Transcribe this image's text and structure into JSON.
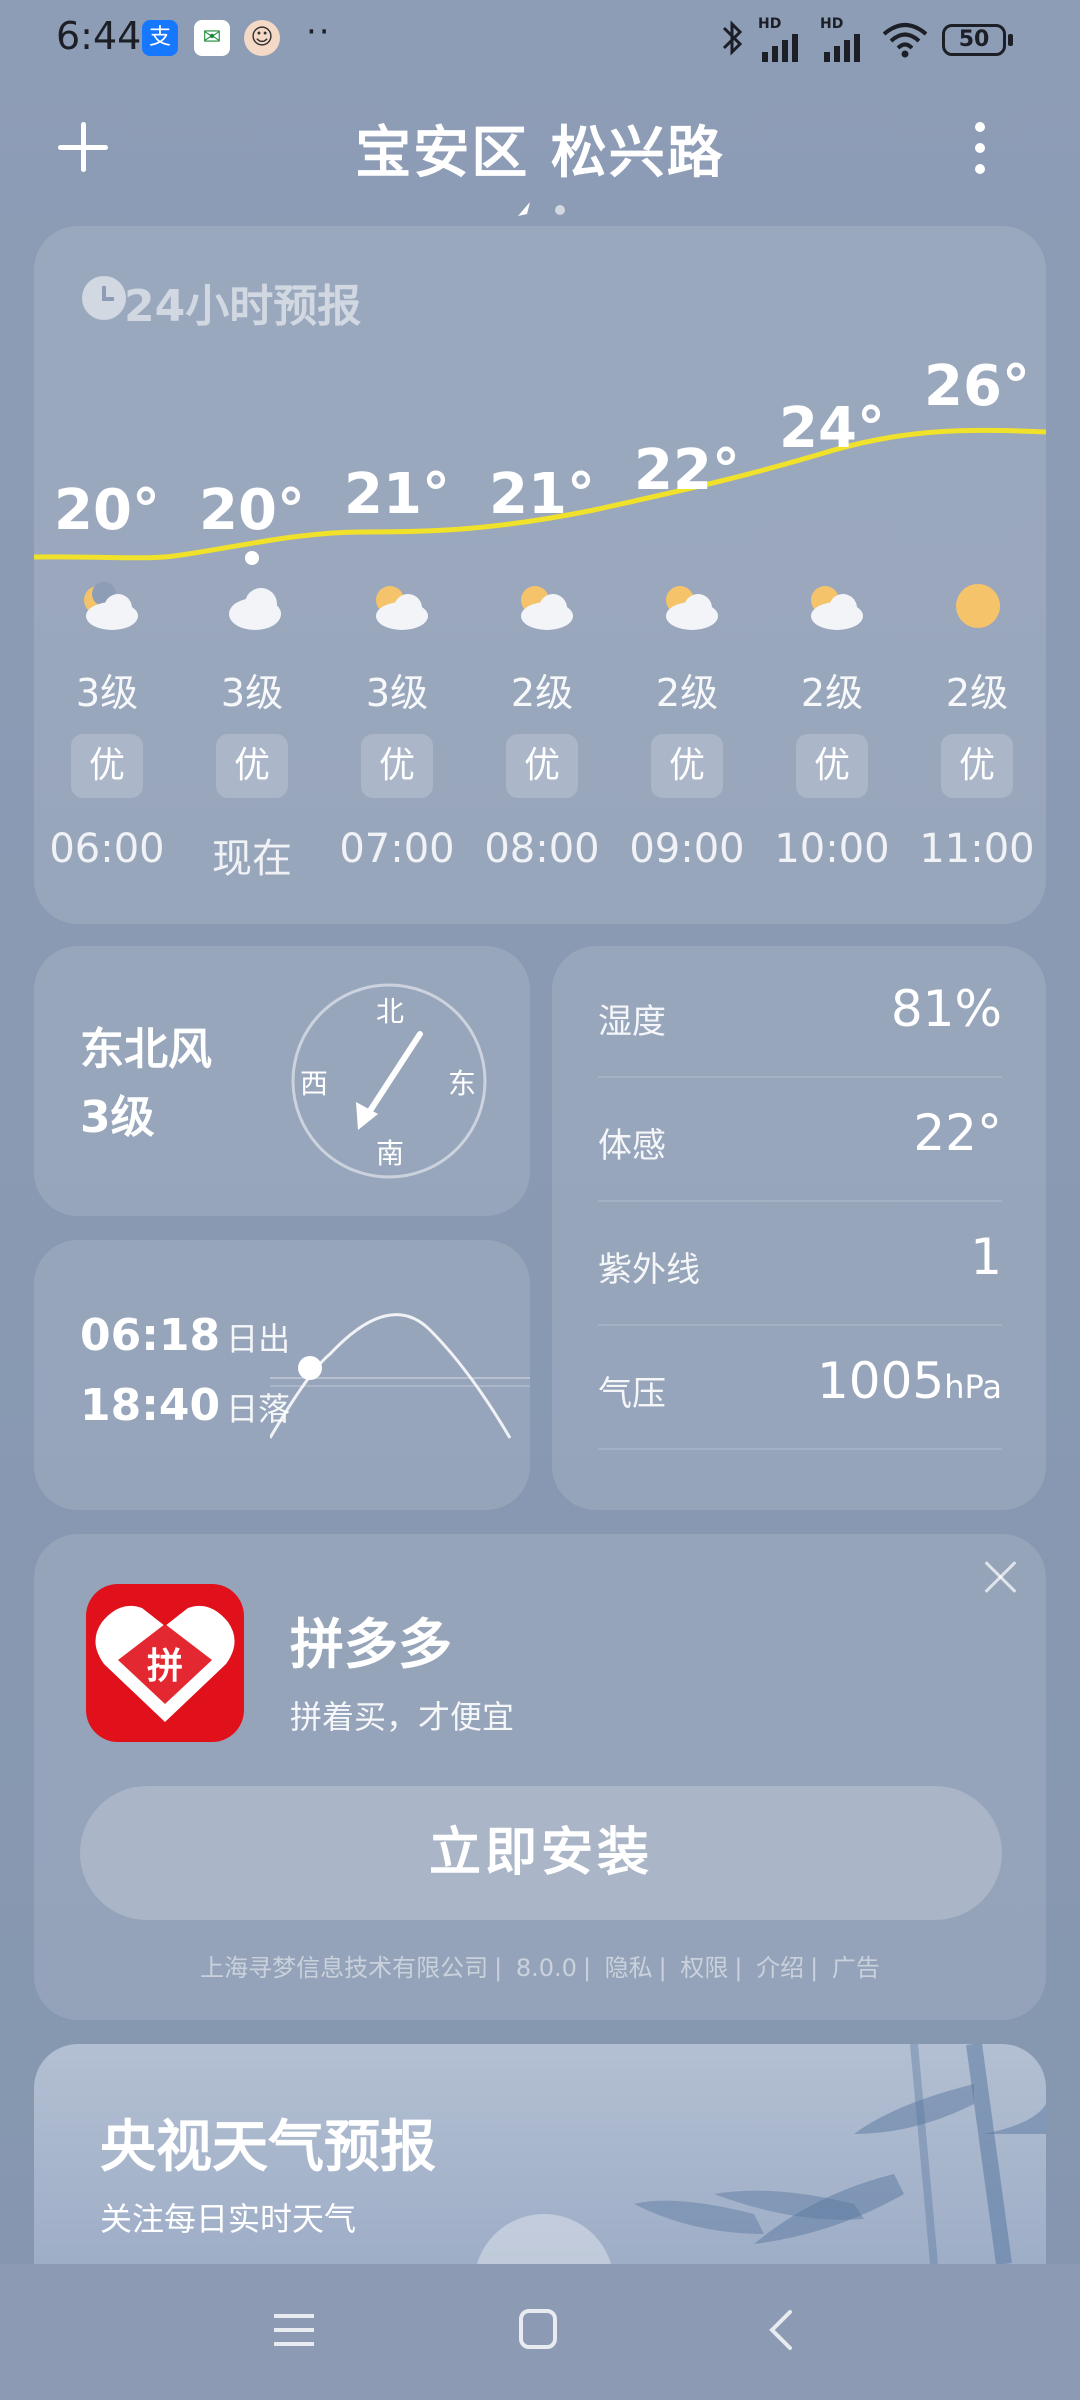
{
  "status_bar": {
    "time": "6:44",
    "battery": "50",
    "app_icons": [
      "alipay-icon",
      "post-app-icon",
      "avatar-icon"
    ],
    "signal_labels": [
      "HD",
      "HD"
    ]
  },
  "header": {
    "location": "宝安区 松兴路"
  },
  "hourly": {
    "title": "24小时预报",
    "hours": [
      {
        "label": "06:00",
        "temp": "20°",
        "wind": "3级",
        "aqi": "优",
        "icon": "moon-cloud-icon"
      },
      {
        "label": "现在",
        "temp": "20°",
        "wind": "3级",
        "aqi": "优",
        "icon": "cloud-icon"
      },
      {
        "label": "07:00",
        "temp": "21°",
        "wind": "3级",
        "aqi": "优",
        "icon": "sun-cloud-icon"
      },
      {
        "label": "08:00",
        "temp": "21°",
        "wind": "2级",
        "aqi": "优",
        "icon": "sun-cloud-icon"
      },
      {
        "label": "09:00",
        "temp": "22°",
        "wind": "2级",
        "aqi": "优",
        "icon": "sun-cloud-icon"
      },
      {
        "label": "10:00",
        "temp": "24°",
        "wind": "2级",
        "aqi": "优",
        "icon": "sun-cloud-icon"
      },
      {
        "label": "11:00",
        "temp": "26°",
        "wind": "2级",
        "aqi": "优",
        "icon": "sun-icon"
      }
    ]
  },
  "wind": {
    "direction": "东北风",
    "level": "3级",
    "compass": {
      "north": "北",
      "south": "南",
      "east": "东",
      "west": "西"
    }
  },
  "sun": {
    "sunrise_time": "06:18",
    "sunrise_label": "日出",
    "sunset_time": "18:40",
    "sunset_label": "日落"
  },
  "details": {
    "humidity_label": "湿度",
    "humidity": "81%",
    "feels_label": "体感",
    "feels": "22°",
    "uv_label": "紫外线",
    "uv": "1",
    "pressure_label": "气压",
    "pressure": "1005",
    "pressure_unit": "hPa"
  },
  "ad": {
    "app_name": "拼多多",
    "slogan": "拼着买，才便宜",
    "install_label": "立即安装",
    "icon_char": "拼",
    "meta": [
      "上海寻梦信息技术有限公司",
      "8.0.0",
      "隐私",
      "权限",
      "介绍",
      "广告"
    ]
  },
  "cctv": {
    "title": "央视天气预报",
    "subtitle": "关注每日实时天气"
  },
  "colors": {
    "background": "#8e9db6",
    "temp_line": "#f0e12a",
    "ad_icon": "#e0111b"
  }
}
